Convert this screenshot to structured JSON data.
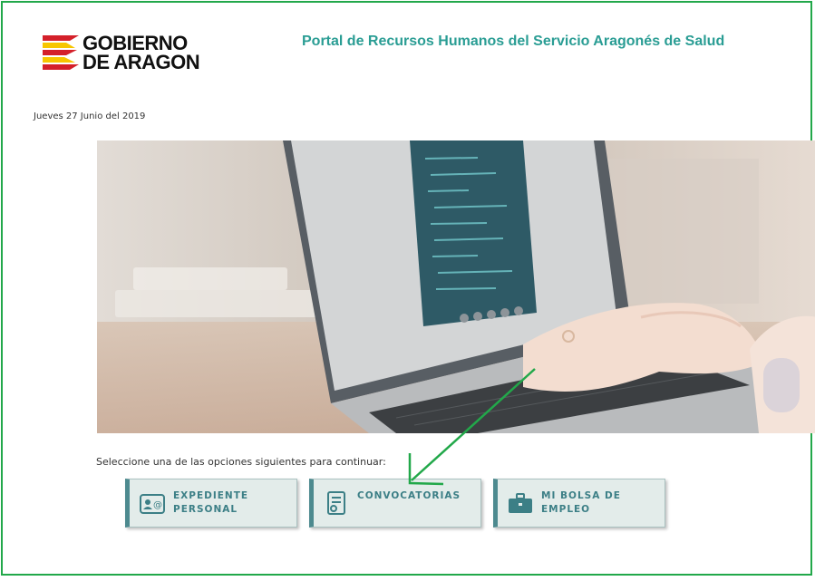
{
  "header": {
    "logo_text": "GOBIERNO\nDE ARAGON",
    "portal_title": "Portal de Recursos Humanos del Servicio Aragonés de Salud"
  },
  "date": "Jueves 27 Junio del 2019",
  "instruction": "Seleccione una de las opciones siguientes para continuar:",
  "options": [
    {
      "label": "EXPEDIENTE\nPERSONAL",
      "icon": "id-card-icon"
    },
    {
      "label": "CONVOCATORIAS",
      "icon": "document-certificate-icon"
    },
    {
      "label": "MI BOLSA DE\nEMPLEO",
      "icon": "briefcase-icon"
    }
  ],
  "colors": {
    "title": "#2a9d94",
    "option_bg": "#e3ecea",
    "option_accent": "#4d8a8f",
    "annotation": "#22a84a",
    "logo_red": "#d4202a",
    "logo_yellow": "#f7c600"
  }
}
